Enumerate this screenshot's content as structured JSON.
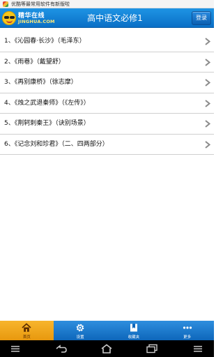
{
  "notification": {
    "text": "优酷等最常用软件有新版啦",
    "icon": "app-store-icon"
  },
  "header": {
    "logo_cn": "精华在线",
    "logo_en": "JINGHUA.COM",
    "title": "高中语文必修1",
    "login_label": "登录",
    "color": "#0a6fc6"
  },
  "list": {
    "items": [
      {
        "label": "1、《沁园春·长沙》（毛泽东）"
      },
      {
        "label": "2、《雨巷》（戴望舒）"
      },
      {
        "label": "3、《再别康桥》（徐志摩）"
      },
      {
        "label": "4、《烛之武退秦师》（《左传》）"
      },
      {
        "label": "5、《荆轲刺秦王》（诀别场景）"
      },
      {
        "label": "6、《记念刘和珍君》（二、四两部分）"
      }
    ],
    "arrow_icon": "chevron-right-icon"
  },
  "tabs": [
    {
      "label": "首页",
      "icon": "home-icon",
      "active": true
    },
    {
      "label": "设置",
      "icon": "gear-icon",
      "active": false
    },
    {
      "label": "收藏夹",
      "icon": "bookmark-icon",
      "active": false
    },
    {
      "label": "更多",
      "icon": "more-icon",
      "active": false
    }
  ],
  "system_nav": {
    "buttons": [
      "menu-icon",
      "back-icon",
      "home-icon",
      "recent-apps-icon",
      "menu-icon"
    ]
  },
  "colors": {
    "accent": "#0a6fc6",
    "active_tab": "#f0a51c"
  }
}
